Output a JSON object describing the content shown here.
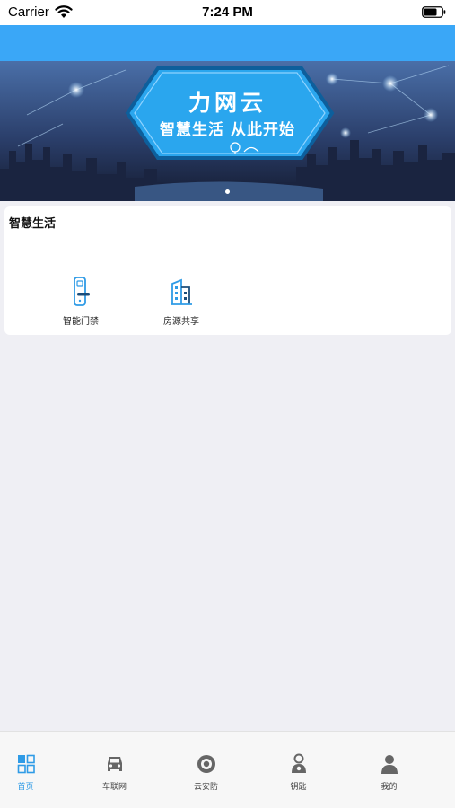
{
  "status_bar": {
    "carrier": "Carrier",
    "time": "7:24 PM"
  },
  "banner": {
    "title": "力网云",
    "subtitle": "智慧生活 从此开始"
  },
  "section": {
    "title": "智慧生活",
    "services": [
      {
        "label": "智能门禁",
        "icon": "smart-lock-icon"
      },
      {
        "label": "房源共享",
        "icon": "building-icon"
      }
    ]
  },
  "tab_bar": {
    "tabs": [
      {
        "label": "首页",
        "icon": "grid-icon",
        "active": true
      },
      {
        "label": "车联网",
        "icon": "car-icon",
        "active": false
      },
      {
        "label": "云安防",
        "icon": "camera-icon",
        "active": false
      },
      {
        "label": "钥匙",
        "icon": "key-person-icon",
        "active": false
      },
      {
        "label": "我的",
        "icon": "person-icon",
        "active": false
      }
    ]
  },
  "colors": {
    "nav_blue": "#3aa7f7",
    "tab_active": "#2f9be6",
    "tab_inactive": "#666666",
    "background": "#efeff4"
  }
}
